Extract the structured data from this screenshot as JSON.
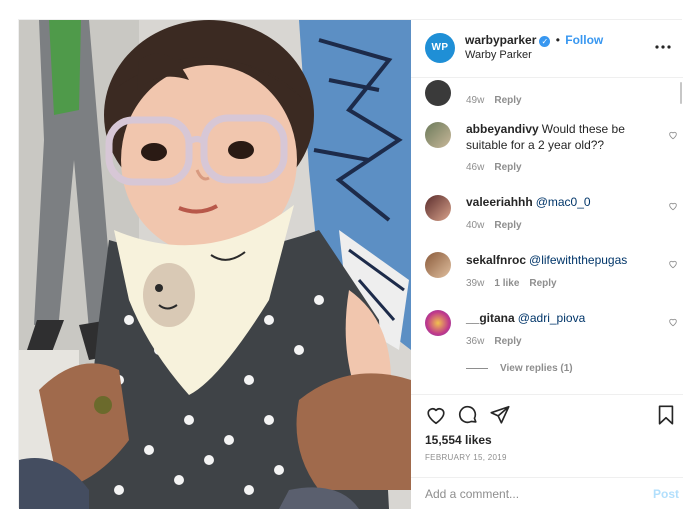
{
  "header": {
    "avatar_text": "WP",
    "username": "warbyparker",
    "verified_icon": "verified-badge-icon",
    "separator": "•",
    "follow_label": "Follow",
    "full_name": "Warby Parker",
    "more_label": "•••"
  },
  "comments": [
    {
      "username": "",
      "text": "",
      "age": "49w",
      "likes": "",
      "reply_label": "Reply"
    },
    {
      "username": "abbeyandivy",
      "text": "Would these be suitable for a 2 year old??",
      "age": "46w",
      "likes": "",
      "reply_label": "Reply"
    },
    {
      "username": "valeeriahhh",
      "text": "@mac0_0",
      "age": "40w",
      "likes": "",
      "reply_label": "Reply"
    },
    {
      "username": "sekalfnroc",
      "text": "@lifewiththepugas",
      "age": "39w",
      "likes": "1 like",
      "reply_label": "Reply"
    },
    {
      "username": "__gitana",
      "text": "@adri_piova",
      "age": "36w",
      "likes": "",
      "reply_label": "Reply"
    }
  ],
  "view_replies_label": "View replies (1)",
  "actions": {
    "like_icon": "heart-icon",
    "comment_icon": "comment-icon",
    "share_icon": "share-icon",
    "save_icon": "bookmark-icon"
  },
  "likes_count": "15,554 likes",
  "post_date": "FEBRUARY 15, 2019",
  "add_comment": {
    "placeholder": "Add a comment...",
    "post_label": "Post"
  },
  "colors": {
    "accent": "#3897f0",
    "post_disabled": "#b2dffc",
    "meta_text": "#8e8e8e",
    "brand_avatar": "#1f8fd6"
  }
}
